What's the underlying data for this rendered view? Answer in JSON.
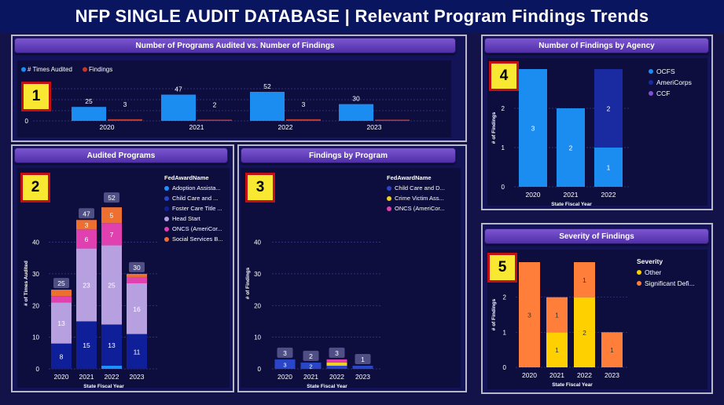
{
  "header": {
    "title": "NFP SINGLE AUDIT DATABASE  |  Relevant Program Findings Trends"
  },
  "panels": {
    "p1": {
      "title": "Number of Programs Audited vs. Number of Findings",
      "badge": "1"
    },
    "p2": {
      "title": "Audited Programs",
      "badge": "2"
    },
    "p3": {
      "title": "Findings by Program",
      "badge": "3"
    },
    "p4": {
      "title": "Number of Findings by Agency",
      "badge": "4"
    },
    "p5": {
      "title": "Severity of Findings",
      "badge": "5"
    }
  },
  "colors": {
    "times_audited": "#1b8cf0",
    "findings": "#c0392b",
    "adoption": "#1e90ff",
    "child_care": "#2a46c8",
    "foster": "#0f1f9a",
    "head_start": "#b7a0e0",
    "oncs": "#e040b0",
    "social": "#ee7030",
    "crime": "#f0d020",
    "ocfs": "#1b8cf0",
    "americorps": "#1a2aa0",
    "ccf": "#8050d0",
    "other": "#ffd000",
    "significant": "#ff7f3a"
  },
  "chart_data": [
    {
      "id": "programs-vs-findings",
      "type": "bar",
      "title": "Number of Programs Audited vs. Number of Findings",
      "categories": [
        "2020",
        "2021",
        "2022",
        "2023"
      ],
      "series": [
        {
          "name": "# Times Audited",
          "values": [
            25,
            47,
            52,
            30
          ]
        },
        {
          "name": "Findings",
          "values": [
            3,
            2,
            3,
            0
          ]
        }
      ],
      "yticks": [
        "0"
      ],
      "legend": "top-left"
    },
    {
      "id": "audited-programs",
      "type": "bar",
      "stacked": true,
      "title": "Audited Programs",
      "xlabel": "State Fiscal Year",
      "ylabel": "# of Times Audited",
      "categories": [
        "2020",
        "2021",
        "2022",
        "2023"
      ],
      "ylim": [
        0,
        54
      ],
      "yticks": [
        0,
        10,
        20,
        30,
        40
      ],
      "legend_title": "FedAwardName",
      "series": [
        {
          "name": "Adoption Assista...",
          "values": [
            0,
            0,
            1,
            0
          ]
        },
        {
          "name": "Child Care and ...",
          "values": [
            0,
            0,
            0,
            0
          ]
        },
        {
          "name": "Foster Care Title ...",
          "values": [
            8,
            15,
            13,
            11
          ]
        },
        {
          "name": "Head Start",
          "values": [
            13,
            23,
            25,
            16
          ]
        },
        {
          "name": "ONCS (AmeriCor...",
          "values": [
            2,
            6,
            7,
            2
          ]
        },
        {
          "name": "Social Services B...",
          "values": [
            2,
            3,
            5,
            1
          ]
        }
      ],
      "totals": [
        25,
        47,
        52,
        30
      ]
    },
    {
      "id": "findings-by-program",
      "type": "bar",
      "stacked": true,
      "title": "Findings by Program",
      "xlabel": "State Fiscal Year",
      "ylabel": "# of Findings",
      "categories": [
        "2020",
        "2021",
        "2022",
        "2023"
      ],
      "ylim": [
        0,
        54
      ],
      "yticks": [
        0,
        10,
        20,
        30,
        40
      ],
      "legend_title": "FedAwardName",
      "series": [
        {
          "name": "Child Care and D...",
          "values": [
            3,
            2,
            1,
            1
          ]
        },
        {
          "name": "Crime Victim Ass...",
          "values": [
            0,
            0,
            1,
            0
          ]
        },
        {
          "name": "ONCS (AmeriCor...",
          "values": [
            0,
            0,
            1,
            0
          ]
        }
      ],
      "totals": [
        3,
        2,
        3,
        1
      ]
    },
    {
      "id": "findings-by-agency",
      "type": "bar",
      "stacked": true,
      "title": "Number of Findings by Agency",
      "xlabel": "State Fiscal Year",
      "ylabel": "# of Findings",
      "categories": [
        "2020",
        "2021",
        "2022"
      ],
      "ylim": [
        0,
        3
      ],
      "yticks": [
        0,
        1,
        2
      ],
      "series": [
        {
          "name": "OCFS",
          "values": [
            3,
            2,
            1
          ]
        },
        {
          "name": "AmeriCorps",
          "values": [
            0,
            0,
            2
          ]
        },
        {
          "name": "CCF",
          "values": [
            0,
            0,
            0
          ]
        }
      ]
    },
    {
      "id": "severity",
      "type": "bar",
      "stacked": true,
      "title": "Severity of Findings",
      "xlabel": "State Fiscal Year",
      "ylabel": "# of Findings",
      "categories": [
        "2020",
        "2021",
        "2022",
        "2023"
      ],
      "ylim": [
        0,
        3
      ],
      "yticks": [
        0,
        1,
        2
      ],
      "legend_title": "Severity",
      "series": [
        {
          "name": "Other",
          "values": [
            0,
            1,
            2,
            0
          ]
        },
        {
          "name": "Significant Defi...",
          "values": [
            3,
            1,
            1,
            1
          ]
        }
      ]
    }
  ]
}
